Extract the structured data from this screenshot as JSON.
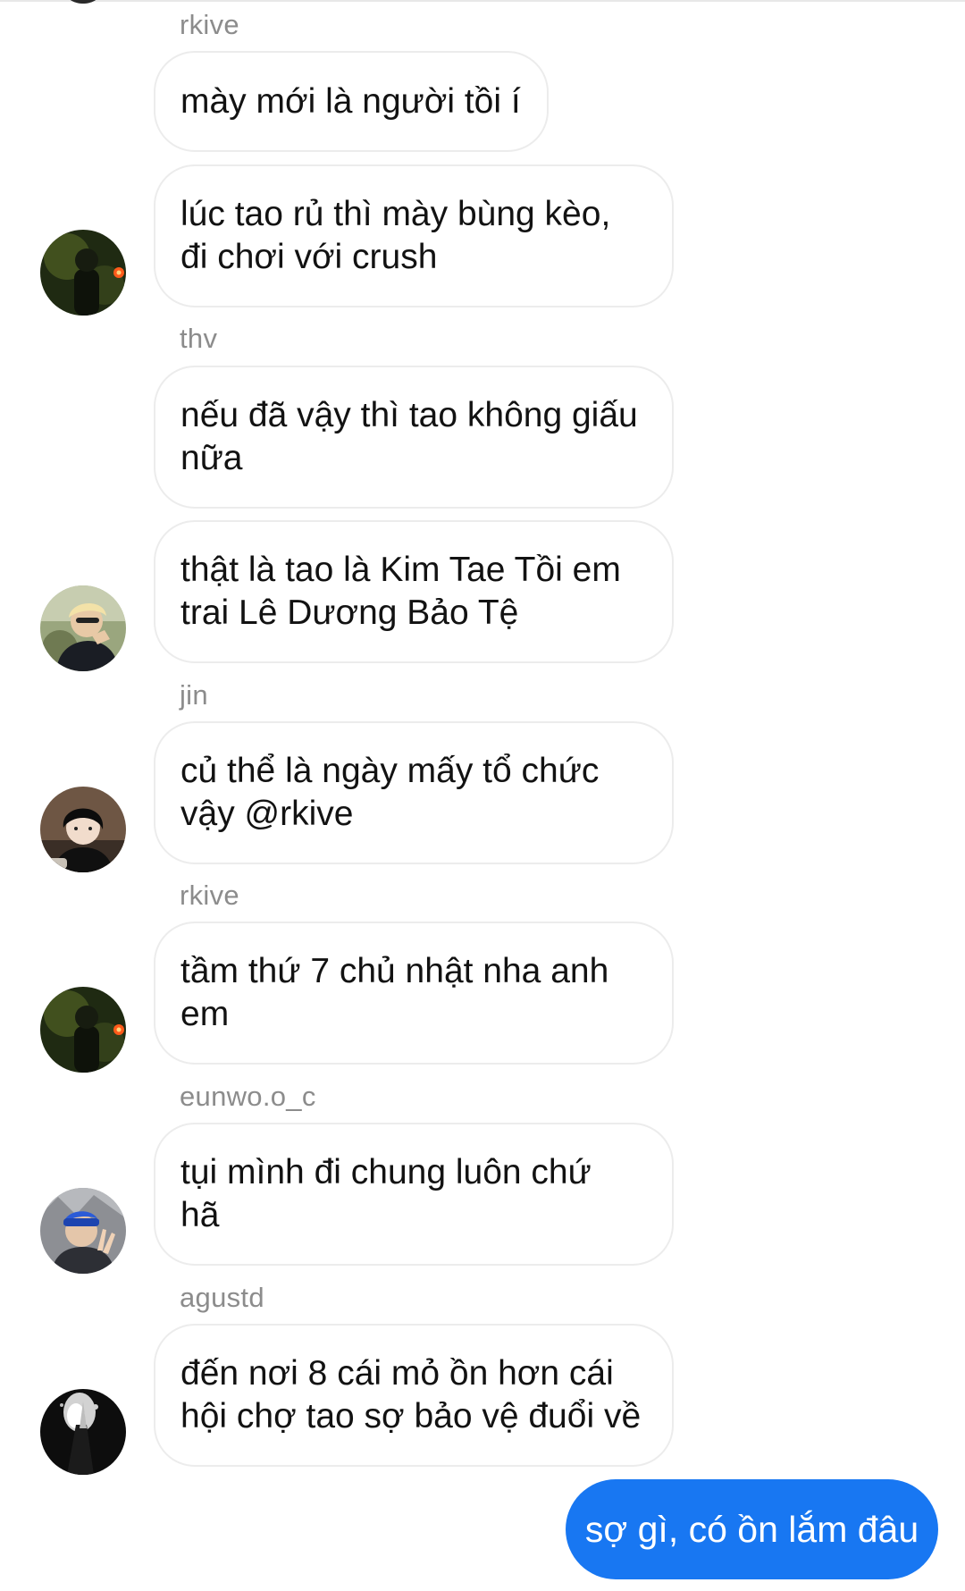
{
  "conversation": {
    "messages": [
      {
        "sender": "rkive",
        "text": "mày mới là người tồi í"
      },
      {
        "sender": "",
        "text": "lúc tao rủ thì mày bùng kèo, đi chơi với  crush",
        "line1": "lúc tao rủ thì mày bùng kèo,",
        "line2": "đi chơi với  crush"
      },
      {
        "sender": "thv",
        "text": "nếu đã vậy thì tao không giấu nữa",
        "line1": "nếu đã vậy thì tao không giấu",
        "line2": "nữa"
      },
      {
        "sender": "",
        "text": "thật là tao là Kim Tae Tồi em trai Lê Dương Bảo Tệ",
        "line1": "thật là tao là Kim Tae Tồi em",
        "line2": "trai Lê Dương Bảo Tệ"
      },
      {
        "sender": "jin",
        "text": "củ thể là ngày mấy tổ chức vậy @rkive",
        "line1": "củ thể là ngày mấy tổ chức",
        "line2": "vậy @rkive"
      },
      {
        "sender": "rkive",
        "text": "tầm thứ 7 chủ nhật nha anh em",
        "line1": "tầm thứ 7 chủ nhật nha anh",
        "line2": "em"
      },
      {
        "sender": "eunwo.o_c",
        "text": "tụi mình đi chung luôn chứ hã",
        "line1": "tụi mình đi chung luôn chứ",
        "line2": "hã"
      },
      {
        "sender": "agustd",
        "text": "đến nơi 8 cái mỏ ồn hơn cái hội chợ tao sợ bảo vệ đuổi về",
        "line1": "đến nơi 8 cái mỏ ồn hơn cái",
        "line2": "hội chợ tao sợ bảo vệ đuổi về"
      }
    ],
    "outgoing": {
      "text": "sợ gì, có ồn lắm đâu"
    }
  },
  "colors": {
    "outgoing_bubble": "#1877f2",
    "incoming_border": "#ececec",
    "sender_name": "#8c8c8c"
  }
}
